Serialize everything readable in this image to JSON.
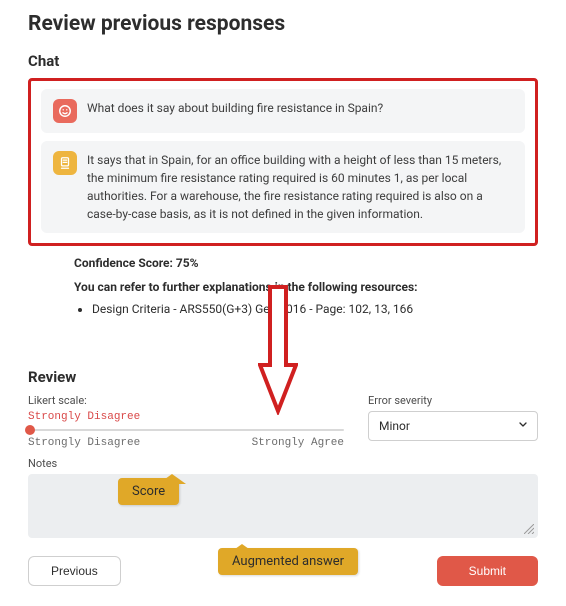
{
  "page": {
    "title": "Review previous responses"
  },
  "chat": {
    "heading": "Chat",
    "user_message": "What does it say about building fire resistance in Spain?",
    "assistant_message": "It says that in Spain, for an office building with a height of less than 15 meters, the minimum fire resistance rating required is 60 minutes 1, as per local authorities. For a warehouse, the fire resistance rating required is also on a case-by-case basis, as it is not defined in the given information."
  },
  "confidence": {
    "label": "Confidence Score: 75%"
  },
  "resources": {
    "intro": "You can refer to further explanations in the following resources:",
    "items": [
      "Design Criteria - ARS550(G+3) Gen 1016 - Page: 102, 13, 166"
    ]
  },
  "review": {
    "heading": "Review",
    "likert": {
      "label": "Likert scale:",
      "value_text": "Strongly Disagree",
      "min_label": "Strongly Disagree",
      "max_label": "Strongly Agree"
    },
    "severity": {
      "label": "Error severity",
      "selected": "Minor"
    },
    "notes": {
      "label": "Notes",
      "value": ""
    },
    "buttons": {
      "previous": "Previous",
      "submit": "Submit"
    }
  },
  "callouts": {
    "score": "Score",
    "augmented": "Augmented answer"
  }
}
